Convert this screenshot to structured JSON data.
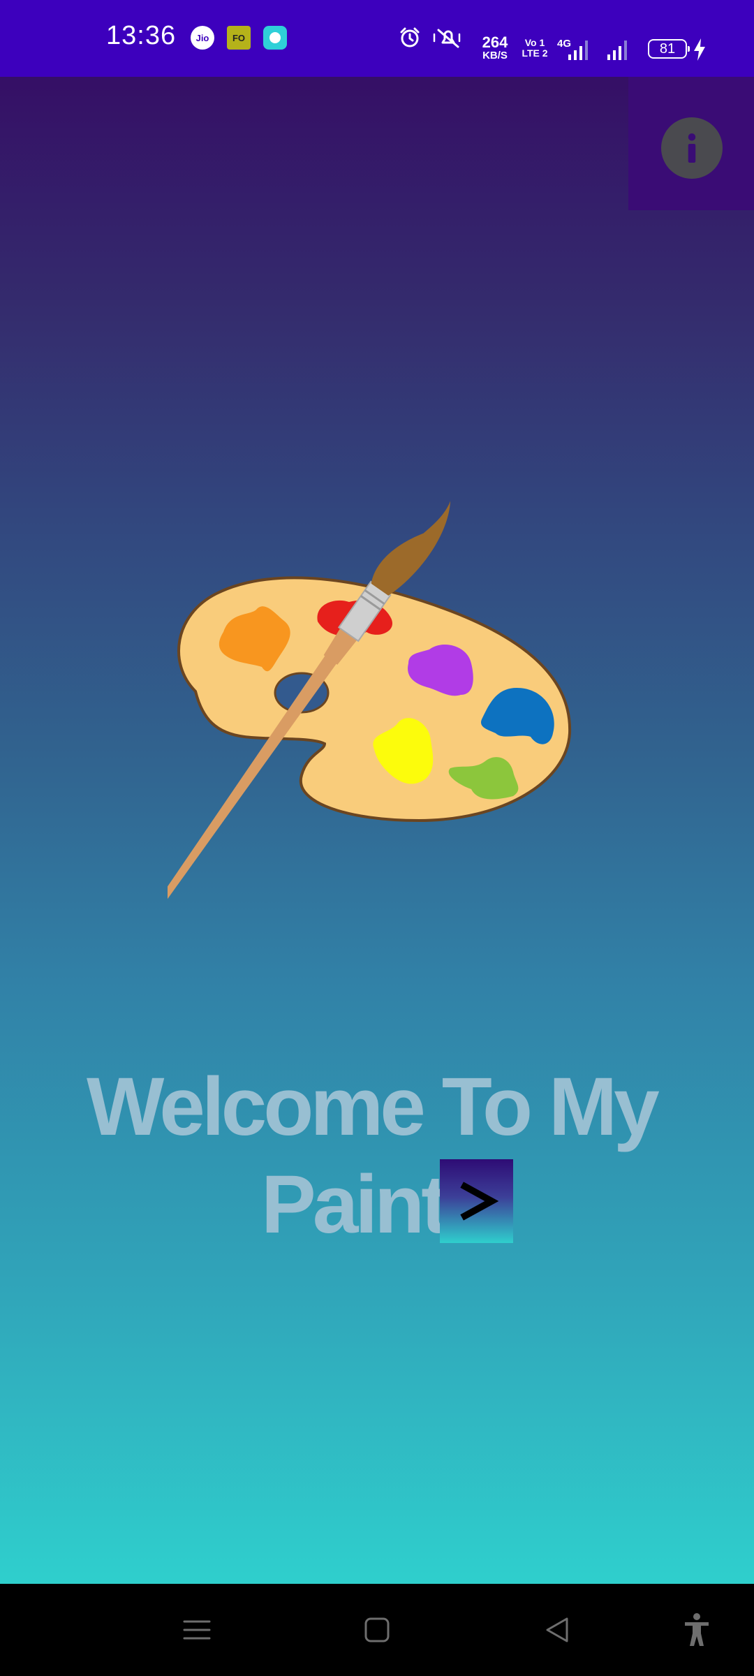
{
  "status_bar": {
    "time": "13:36",
    "notification_icons": {
      "jio_label": "Jio",
      "fo_label": "FO"
    },
    "net_speed_value": "264",
    "net_speed_unit": "KB/S",
    "volte_line1": "Vo 1",
    "volte_line2": "LTE 2",
    "network_type": "4G",
    "battery_level": "81",
    "icons": [
      "alarm-icon",
      "mute-icon",
      "signal-icon",
      "signal-icon",
      "battery-icon",
      "charging-icon"
    ]
  },
  "app": {
    "welcome_line1": "Welcome To My",
    "welcome_line2": "Paint",
    "info_icon": "info-icon",
    "next_icon": "chevron-right-icon",
    "background_top": "#350f66",
    "background_bottom": "#2fcfcd",
    "text_color": "#98bfd2"
  },
  "nav_bar": {
    "icons": [
      "menu-icon",
      "home-icon",
      "back-icon",
      "accessibility-icon"
    ]
  }
}
